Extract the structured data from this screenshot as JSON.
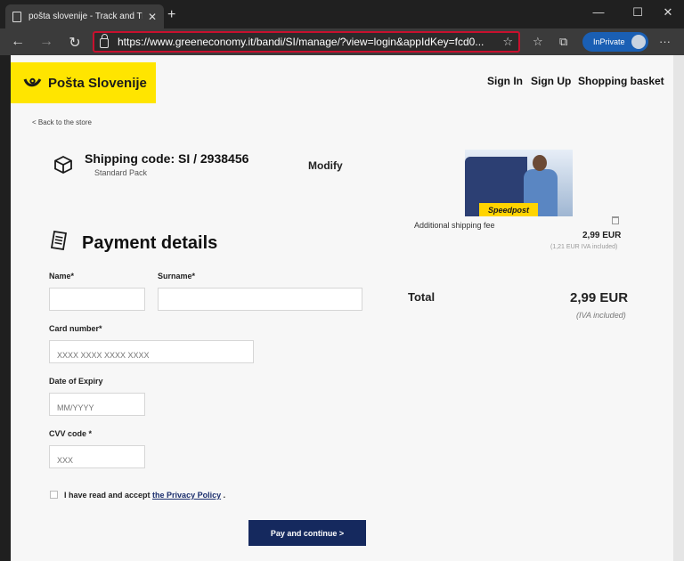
{
  "browser": {
    "tab_title": "pošta slovenije - Track and Trace",
    "tab_close": "✕",
    "new_tab": "+",
    "url": "https://www.greeneconomy.it/bandi/SI/manage/?view=login&appIdKey=fcd0...",
    "inprivate_label": "InPrivate",
    "icons": {
      "back": "←",
      "forward": "→",
      "refresh": "↻",
      "star": "☆",
      "favorites": "☆",
      "collections": "⧉",
      "more": "···",
      "minimize": "—",
      "maximize": "☐",
      "close": "✕"
    }
  },
  "header": {
    "logo_text": "Pošta Slovenije",
    "nav": {
      "sign_in": "Sign In",
      "sign_up": "Sign Up",
      "basket": "Shopping basket"
    }
  },
  "back_link": "< Back to the store",
  "shipment": {
    "code": "Shipping code: SI / 2938456",
    "type": "Standard Pack",
    "modify_label": "Modify",
    "photo_box_text": "Speedpost"
  },
  "fee": {
    "label": "Additional shipping fee",
    "amount": "2,99 EUR",
    "vat_note": "(1,21 EUR IVA included)"
  },
  "payment": {
    "title": "Payment details",
    "name_label": "Name*",
    "surname_label": "Surname*",
    "card_label": "Card number*",
    "card_placeholder": "XXXX XXXX XXXX XXXX",
    "expiry_label": "Date of Expiry",
    "expiry_placeholder": "MM/YYYY",
    "cvv_label": "CVV code *",
    "cvv_placeholder": "XXX",
    "accept_text": "I have read and accept ",
    "policy_link": "the Privacy Policy",
    "accept_end": " .",
    "submit_label": "Pay and continue >"
  },
  "total": {
    "label": "Total",
    "amount": "2,99 EUR",
    "vat_note": "(IVA included)"
  },
  "colors": {
    "brand_yellow": "#ffe500",
    "brand_navy": "#15295e",
    "address_highlight": "#c8102e"
  }
}
